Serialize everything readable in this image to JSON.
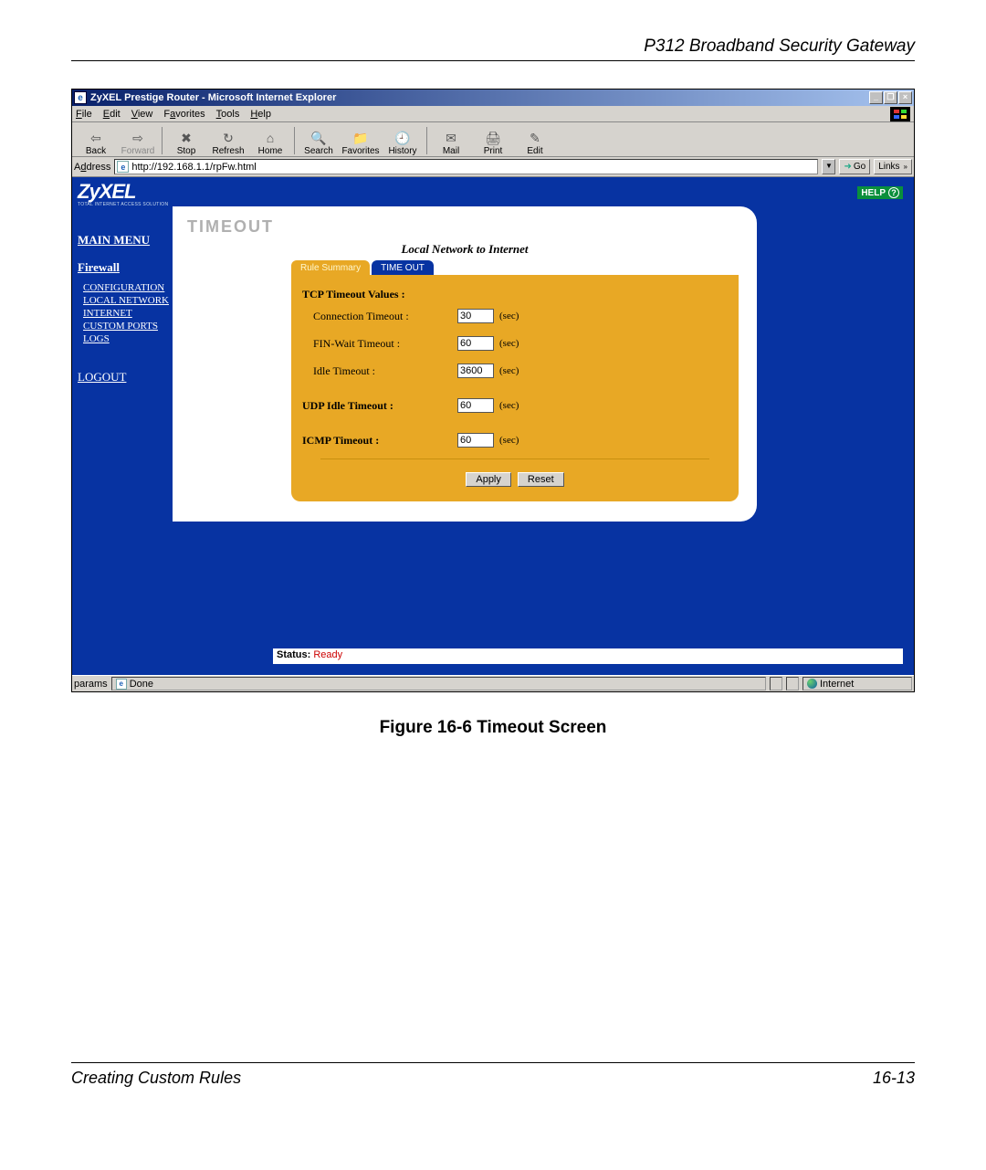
{
  "doc": {
    "header": "P312  Broadband Security Gateway",
    "figure_caption": "Figure 16-6     Timeout Screen",
    "footer_left": "Creating Custom Rules",
    "footer_right": "16-13"
  },
  "window": {
    "title": "ZyXEL Prestige Router - Microsoft Internet Explorer",
    "min": "_",
    "restore": "❐",
    "close": "×"
  },
  "menubar": {
    "file": "File",
    "edit": "Edit",
    "view": "View",
    "favorites": "Favorites",
    "tools": "Tools",
    "help": "Help"
  },
  "toolbar": {
    "back": "Back",
    "forward": "Forward",
    "stop": "Stop",
    "refresh": "Refresh",
    "home": "Home",
    "search": "Search",
    "favorites": "Favorites",
    "history": "History",
    "mail": "Mail",
    "print": "Print",
    "edit": "Edit"
  },
  "address": {
    "label": "Address",
    "url": "http://192.168.1.1/rpFw.html",
    "go": "Go",
    "links": "Links"
  },
  "brand": {
    "name": "ZyXEL",
    "tagline": "TOTAL INTERNET ACCESS SOLUTION"
  },
  "sidebar": {
    "main_menu": "MAIN MENU",
    "category": "Firewall",
    "items": {
      "configuration": "CONFIGURATION",
      "local_network": "LOCAL NETWORK",
      "internet": "INTERNET",
      "custom_ports": "CUSTOM PORTS",
      "logs": "LOGS"
    },
    "logout": "LOGOUT"
  },
  "help": {
    "label": "HELP",
    "q": "?"
  },
  "card": {
    "title": "TIMEOUT",
    "subtitle": "Local Network to Internet",
    "tabs": {
      "rule_summary": "Rule Summary",
      "timeout": "TIME OUT"
    }
  },
  "form": {
    "section_tcp": "TCP Timeout Values :",
    "connection_label": "Connection Timeout :",
    "connection_value": "30",
    "finwait_label": "FIN-Wait Timeout :",
    "finwait_value": "60",
    "idle_label": "Idle Timeout :",
    "idle_value": "3600",
    "udp_label": "UDP Idle Timeout :",
    "udp_value": "60",
    "icmp_label": "ICMP Timeout :",
    "icmp_value": "60",
    "unit": "(sec)",
    "apply": "Apply",
    "reset": "Reset"
  },
  "status": {
    "label": "Status:",
    "value": "Ready"
  },
  "ie_status": {
    "done": "Done",
    "zone": "Internet"
  }
}
